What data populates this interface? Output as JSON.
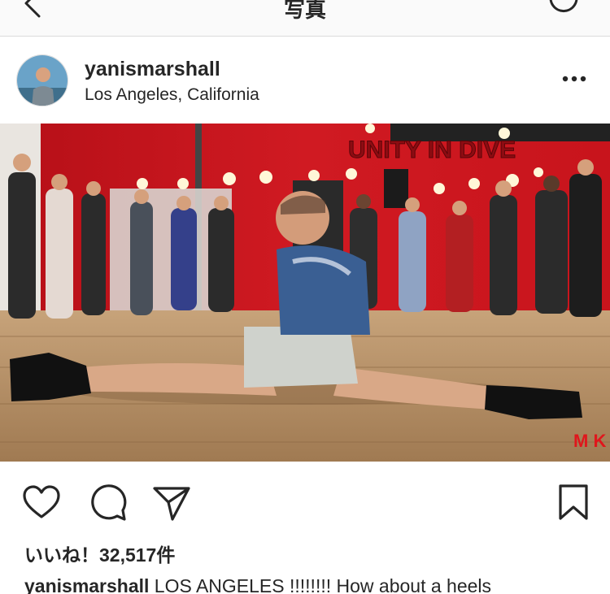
{
  "header": {
    "title": "写真",
    "back_icon": "chevron-left-icon",
    "refresh_icon": "refresh-icon"
  },
  "post": {
    "username": "yanismarshall",
    "location": "Los Angeles, California",
    "more_icon": "more-dots-icon",
    "photo": {
      "wall_text": "UNITY IN DIVE",
      "watermark": "M K",
      "colors": {
        "wall": "#c8141c",
        "floor": "#b08a62"
      }
    },
    "actions": [
      "heart-icon",
      "comment-icon",
      "share-icon",
      "bookmark-icon"
    ],
    "likes_text": "いいね！32,517件",
    "caption": {
      "username": "yanismarshall",
      "text": " LOS ANGELES !!!!!!!! How about a heels"
    }
  }
}
